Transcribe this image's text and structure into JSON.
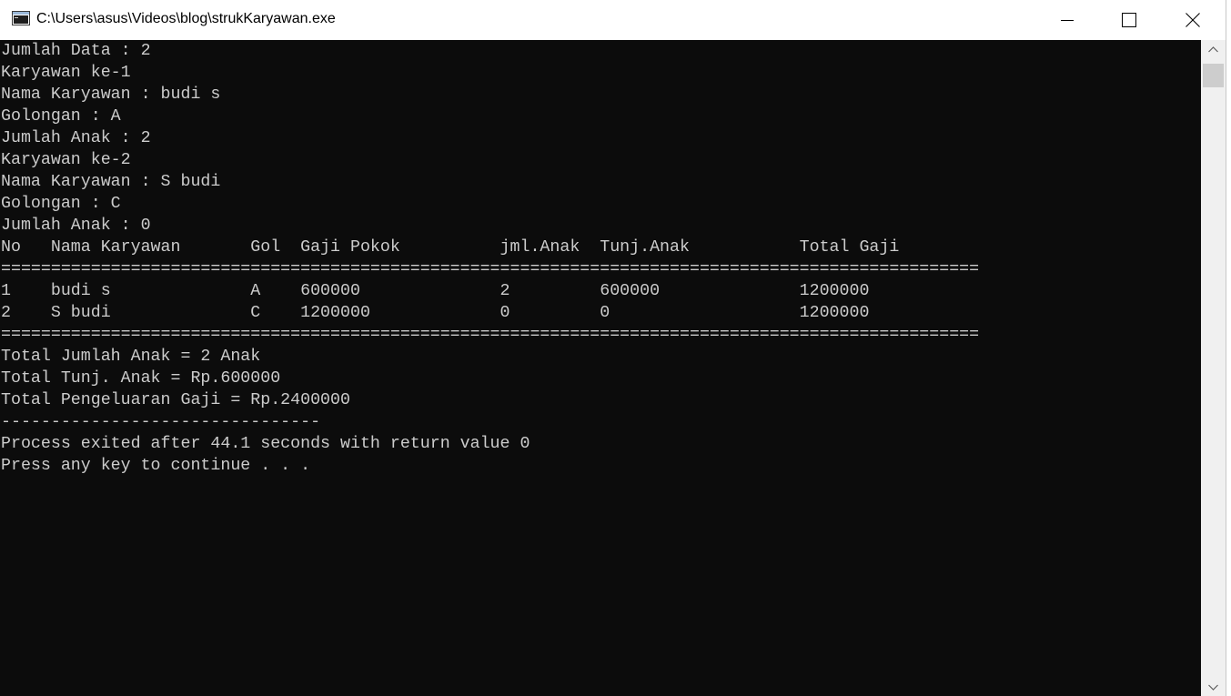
{
  "window": {
    "title": "C:\\Users\\asus\\Videos\\blog\\strukKaryawan.exe"
  },
  "console": {
    "lines": [
      "Jumlah Data : 2",
      "Karyawan ke-1",
      "Nama Karyawan : budi s",
      "Golongan : A",
      "Jumlah Anak : 2",
      "Karyawan ke-2",
      "Nama Karyawan : S budi",
      "Golongan : C",
      "Jumlah Anak : 0",
      "No   Nama Karyawan       Gol  Gaji Pokok          jml.Anak  Tunj.Anak           Total Gaji",
      "==================================================================================================",
      "1    budi s              A    600000              2         600000              1200000",
      "2    S budi              C    1200000             0         0                   1200000",
      "==================================================================================================",
      "Total Jumlah Anak = 2 Anak",
      "Total Tunj. Anak = Rp.600000",
      "Total Pengeluaran Gaji = Rp.2400000",
      "--------------------------------",
      "Process exited after 44.1 seconds with return value 0",
      "Press any key to continue . . ."
    ]
  },
  "icons": {
    "app": "console-app-icon",
    "minimize": "minimize-icon",
    "maximize": "maximize-icon",
    "close": "close-icon",
    "scroll_up": "chevron-up-icon",
    "scroll_down": "chevron-down-icon"
  },
  "colors": {
    "console_background": "#0c0c0c",
    "console_text": "#cccccc",
    "titlebar_background": "#ffffff"
  }
}
